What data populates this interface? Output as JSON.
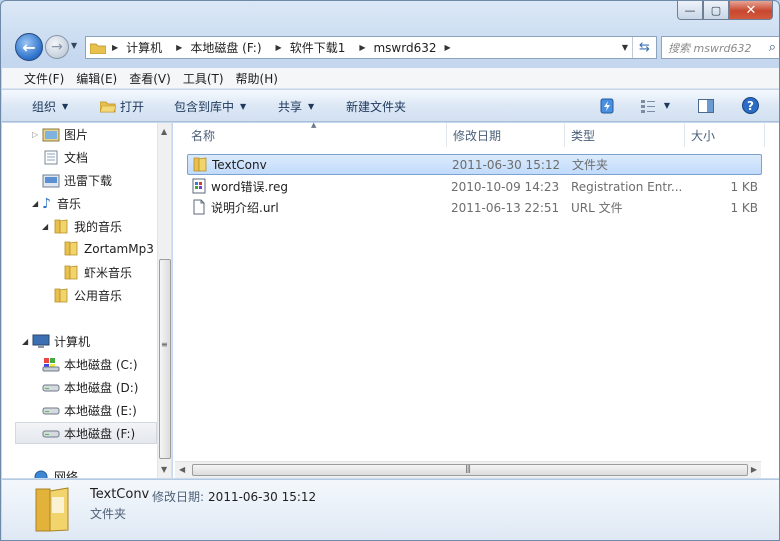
{
  "window": {
    "caption": {
      "minimize": "—",
      "maximize": "▢",
      "close": "✕"
    }
  },
  "address": {
    "crumbs": [
      "计算机",
      "本地磁盘 (F:)",
      "软件下载1",
      "mswrd632"
    ]
  },
  "search": {
    "placeholder": "搜索 mswrd632"
  },
  "menu": [
    "文件(F)",
    "编辑(E)",
    "查看(V)",
    "工具(T)",
    "帮助(H)"
  ],
  "toolbar": {
    "organize": "组织",
    "open": "打开",
    "include": "包含到库中",
    "share": "共享",
    "new_folder": "新建文件夹"
  },
  "tree": [
    {
      "label": "图片",
      "icon": "pictures-icon"
    },
    {
      "label": "文档",
      "icon": "documents-icon"
    },
    {
      "label": "迅雷下载",
      "icon": "thunder-download-icon"
    },
    {
      "label": "音乐",
      "icon": "music-icon"
    },
    {
      "label": "我的音乐",
      "icon": "folder-icon"
    },
    {
      "label": "ZortamMp3",
      "icon": "folder-icon"
    },
    {
      "label": "虾米音乐",
      "icon": "folder-icon"
    },
    {
      "label": "公用音乐",
      "icon": "folder-icon"
    },
    {
      "label": "计算机",
      "icon": "computer-icon"
    },
    {
      "label": "本地磁盘 (C:)",
      "icon": "drive-c-icon"
    },
    {
      "label": "本地磁盘 (D:)",
      "icon": "drive-icon"
    },
    {
      "label": "本地磁盘 (E:)",
      "icon": "drive-icon"
    },
    {
      "label": "本地磁盘 (F:)",
      "icon": "drive-icon"
    },
    {
      "label": "网络",
      "icon": "network-icon"
    }
  ],
  "columns": {
    "name": "名称",
    "date": "修改日期",
    "type": "类型",
    "size": "大小"
  },
  "files": [
    {
      "name": "TextConv",
      "date": "2011-06-30 15:12",
      "type": "文件夹",
      "size": "",
      "icon": "folder-icon"
    },
    {
      "name": "word错误.reg",
      "date": "2010-10-09 14:23",
      "type": "Registration Entr...",
      "size": "1 KB",
      "icon": "reg-file-icon"
    },
    {
      "name": "说明介绍.url",
      "date": "2011-06-13 22:51",
      "type": "URL 文件",
      "size": "1 KB",
      "icon": "url-file-icon"
    }
  ],
  "details": {
    "name": "TextConv",
    "date_label": "修改日期:",
    "date_value": "2011-06-30 15:12",
    "kind": "文件夹"
  },
  "colors": {
    "accent": "#2a6fc9",
    "selection": "#c1dbfc",
    "folder": "#e8c04d"
  }
}
